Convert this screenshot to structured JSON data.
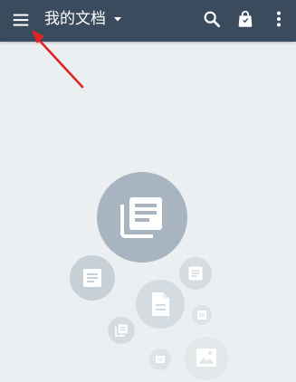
{
  "appbar": {
    "title": "我的文档",
    "background": "#394b5d",
    "icons": [
      "menu-icon",
      "dropdown-caret-icon",
      "search-icon",
      "bag-icon",
      "more-vert-icon"
    ]
  },
  "illustration": {
    "large_circle_color": "#a8b5c0",
    "small_circle_colors": [
      "#c7d0d6",
      "#d5dce1",
      "#dde3e7"
    ],
    "icons": [
      "library-books-icon",
      "document-icon",
      "document-icon",
      "file-icon",
      "document-icon",
      "document-icon",
      "document-icon",
      "image-icon"
    ]
  },
  "annotation": {
    "arrow_color": "#e02424"
  }
}
